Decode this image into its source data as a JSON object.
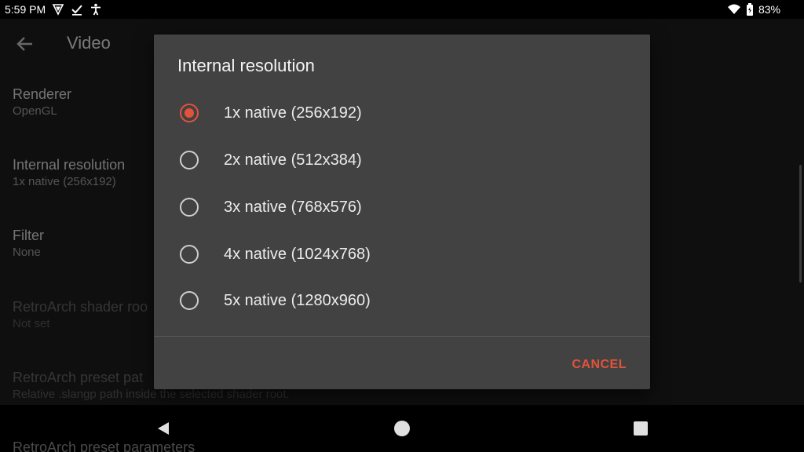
{
  "status_bar": {
    "time": "5:59 PM",
    "battery": "83%",
    "icons": [
      "shield-icon",
      "check-icon",
      "accessibility-icon",
      "wifi-icon",
      "battery-icon"
    ]
  },
  "app": {
    "title": "Video",
    "settings": [
      {
        "title": "Renderer",
        "summary": "OpenGL",
        "enabled": true
      },
      {
        "title": "Internal resolution",
        "summary": "1x native (256x192)",
        "enabled": true
      },
      {
        "title": "Filter",
        "summary": "None",
        "enabled": true
      },
      {
        "title": "RetroArch shader roo",
        "summary": "Not set",
        "enabled": false
      },
      {
        "title": "RetroArch preset pat",
        "summary": "Relative .slangp path inside the selected shader root.",
        "enabled": false
      },
      {
        "title": "RetroArch preset parameters",
        "summary": "",
        "enabled": false
      }
    ]
  },
  "dialog": {
    "title": "Internal resolution",
    "options": [
      {
        "label": "1x native (256x192)",
        "selected": true
      },
      {
        "label": "2x native (512x384)",
        "selected": false
      },
      {
        "label": "3x native (768x576)",
        "selected": false
      },
      {
        "label": "4x native (1024x768)",
        "selected": false
      },
      {
        "label": "5x native (1280x960)",
        "selected": false
      }
    ],
    "cancel_label": "CANCEL"
  },
  "colors": {
    "accent": "#e2533b",
    "dialog_bg": "#424242",
    "app_bg": "#1f1f1f"
  }
}
